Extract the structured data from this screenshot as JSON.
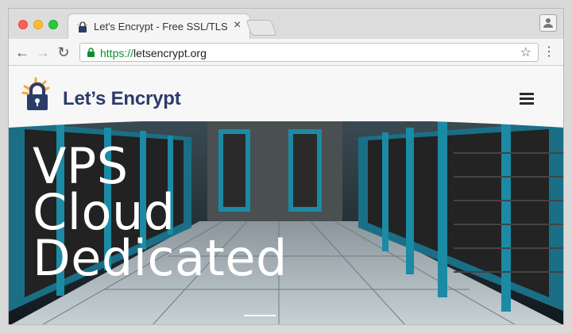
{
  "browser": {
    "tab": {
      "title": "Let's Encrypt - Free SSL/TLS C",
      "close_label": "×"
    },
    "toolbar": {
      "back_label": "←",
      "forward_label": "→",
      "reload_label": "↻",
      "url_scheme": "https://",
      "url_host": "letsencrypt.org",
      "star_label": "☆",
      "menu_label": "⋮"
    }
  },
  "site": {
    "logo_text": "Let’s Encrypt",
    "hero_lines": [
      "VPS",
      "Cloud",
      "Dedicated"
    ]
  },
  "colors": {
    "brand_navy": "#2c3c69",
    "brand_yellow": "#f2a93b",
    "secure_green": "#0b8f2c"
  }
}
